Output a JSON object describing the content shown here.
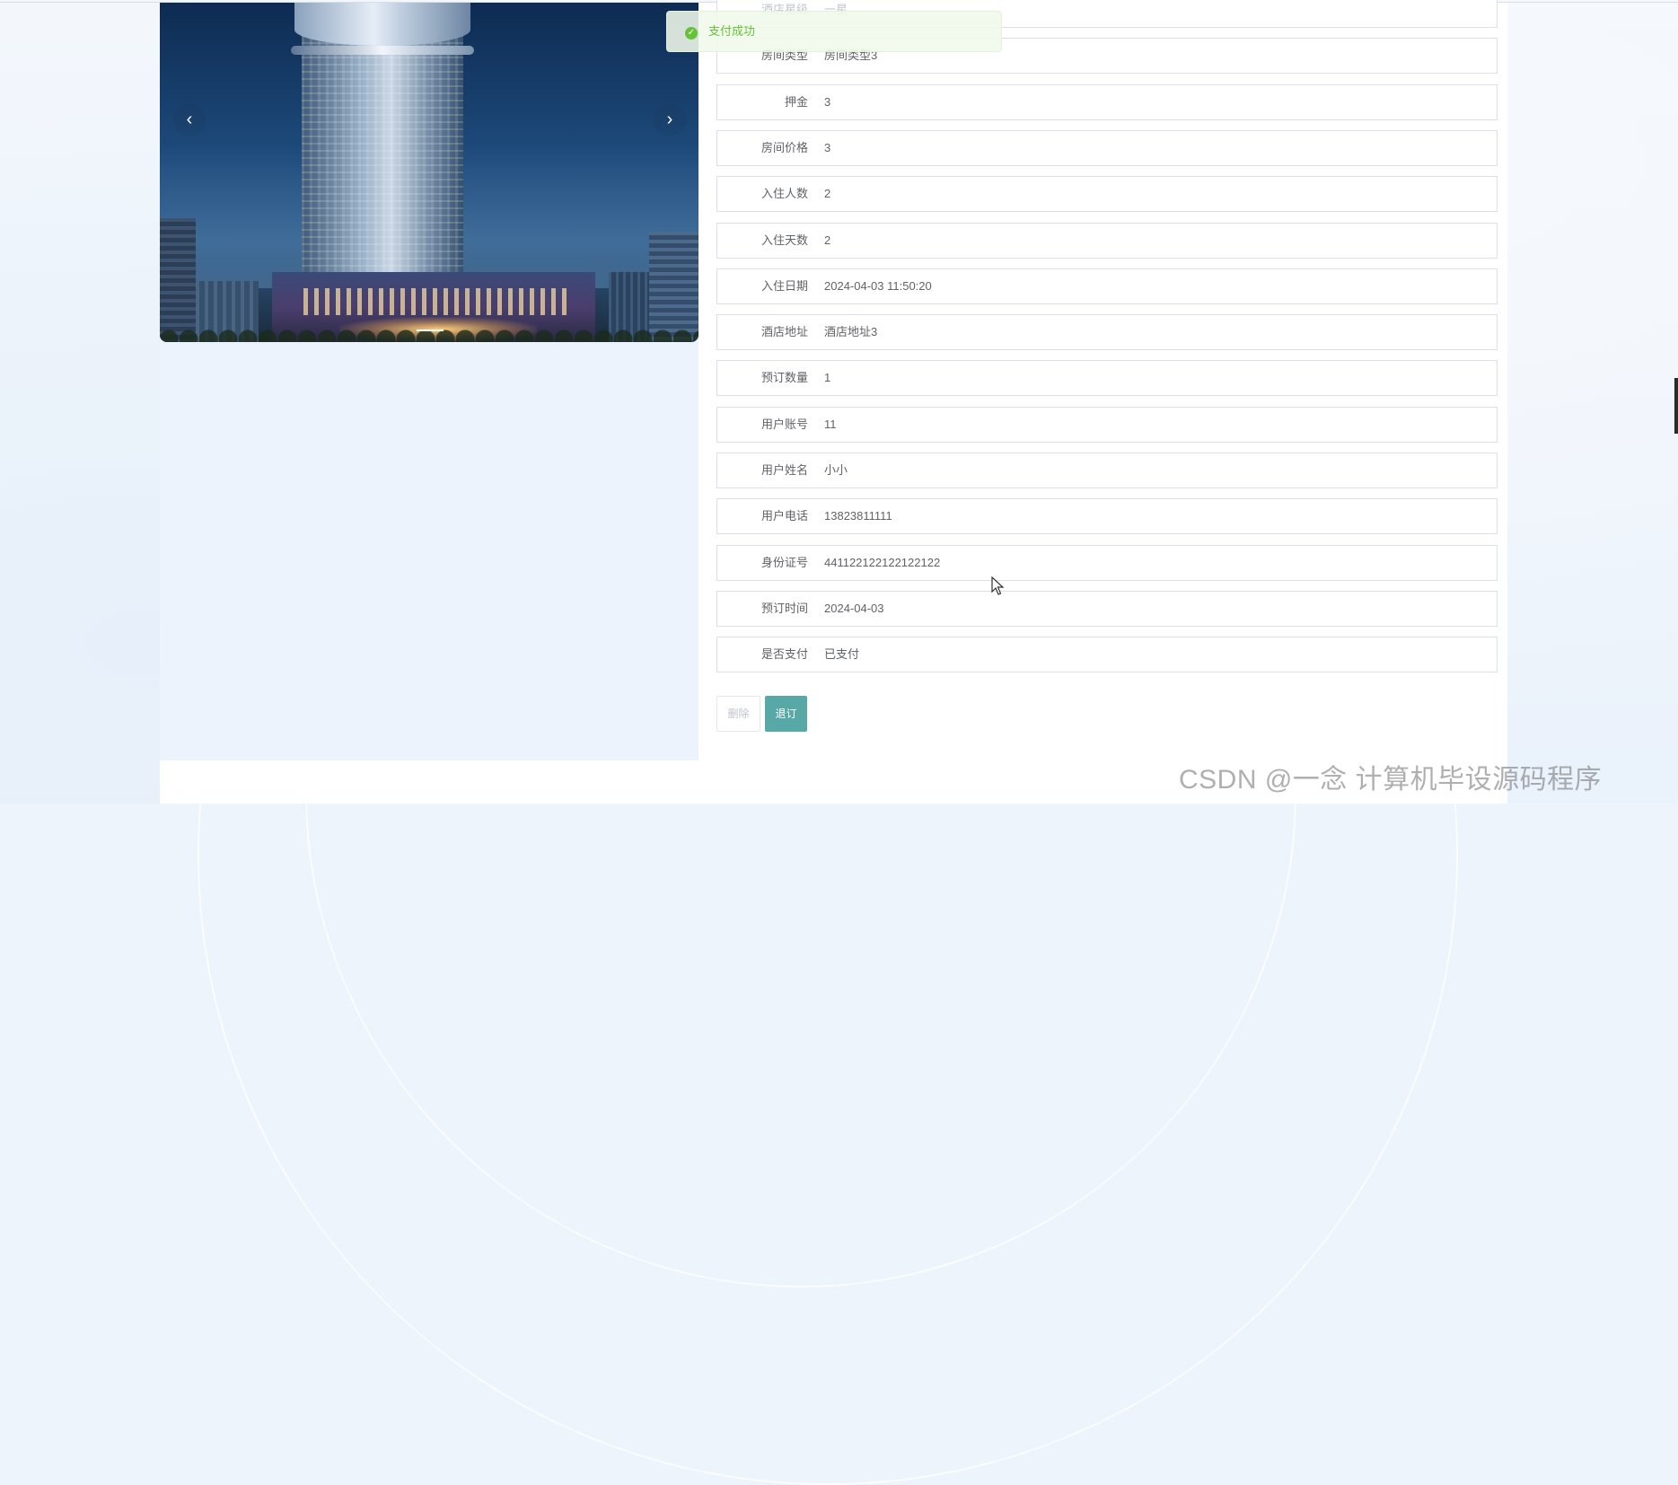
{
  "toast": {
    "message": "支付成功",
    "icon": "check-circle-icon",
    "color": "#67c23a"
  },
  "carousel": {
    "prev_symbol": "‹",
    "next_symbol": "›"
  },
  "details": [
    {
      "label": "酒店星级",
      "value": "一星"
    },
    {
      "label": "房间类型",
      "value": "房间类型3"
    },
    {
      "label": "押金",
      "value": "3"
    },
    {
      "label": "房间价格",
      "value": "3"
    },
    {
      "label": "入住人数",
      "value": "2"
    },
    {
      "label": "入住天数",
      "value": "2"
    },
    {
      "label": "入住日期",
      "value": "2024-04-03 11:50:20"
    },
    {
      "label": "酒店地址",
      "value": "酒店地址3"
    },
    {
      "label": "预订数量",
      "value": "1"
    },
    {
      "label": "用户账号",
      "value": "11"
    },
    {
      "label": "用户姓名",
      "value": "小小"
    },
    {
      "label": "用户电话",
      "value": "13823811111"
    },
    {
      "label": "身份证号",
      "value": "441122122122122122"
    },
    {
      "label": "预订时间",
      "value": "2024-04-03"
    },
    {
      "label": "是否支付",
      "value": "已支付"
    }
  ],
  "actions": {
    "delete_label": "删除",
    "cancel_booking_label": "退订"
  },
  "watermark": "CSDN @一念 计算机毕设源码程序",
  "colors": {
    "primary_button": "#58a8a8",
    "border": "#dcdfe6",
    "text": "#606266"
  }
}
